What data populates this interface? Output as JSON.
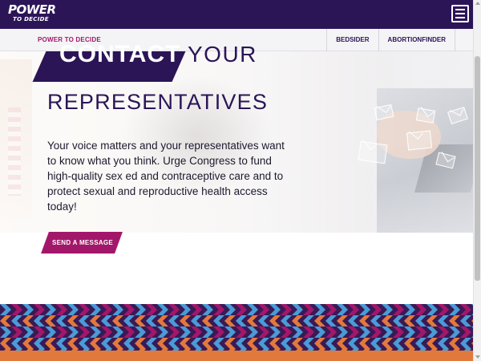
{
  "header": {
    "logo_line1": "POWER",
    "logo_line2": "TO DECIDE",
    "menu_icon": "hamburger-menu-icon"
  },
  "subnav": {
    "brand": "POWER TO DECIDE",
    "links": [
      "BEDSIDER",
      "ABORTIONFINDER"
    ]
  },
  "hero": {
    "title_highlight": "CONTACT",
    "title_rest": "YOUR",
    "title_line2": "REPRESENTATIVES",
    "body": "Your voice matters and your representatives want to know what you think. Urge Congress to fund high-quality sex ed and contraceptive care and to protect sexual and reproductive health access today!",
    "cta_label": "SEND A MESSAGE",
    "decoration_icon": "envelope-icon"
  },
  "colors": {
    "brand_purple": "#2b1557",
    "accent_magenta": "#a3176b",
    "band_orange": "#e2793c",
    "band_blue": "#4a9bd6"
  }
}
